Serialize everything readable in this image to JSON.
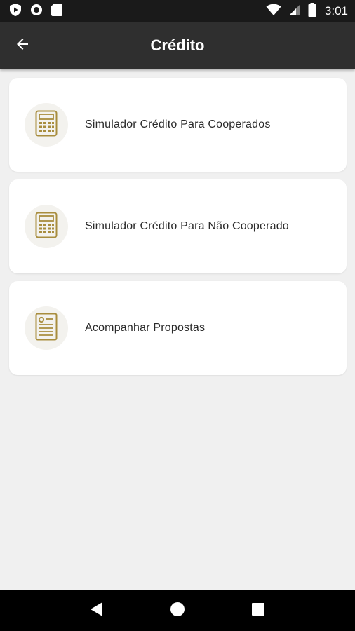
{
  "status_bar": {
    "time": "3:01",
    "icons_left": [
      "play-protect-icon",
      "circle-icon",
      "sd-card-icon"
    ],
    "icons_right": [
      "wifi-icon",
      "signal-icon",
      "battery-icon"
    ]
  },
  "app_bar": {
    "title": "Crédito",
    "back_icon": "arrow-left-icon"
  },
  "menu": {
    "items": [
      {
        "label": "Simulador Crédito Para Cooperados",
        "icon": "calculator-icon"
      },
      {
        "label": "Simulador Crédito Para Não Cooperado",
        "icon": "calculator-icon"
      },
      {
        "label": "Acompanhar Propostas",
        "icon": "document-icon"
      }
    ]
  },
  "nav_bar": {
    "buttons": [
      "back-triangle-icon",
      "home-circle-icon",
      "recents-square-icon"
    ]
  },
  "colors": {
    "status_bar_bg": "#1a1a1a",
    "app_bar_bg": "#2f2f2f",
    "page_bg": "#f0f0f0",
    "card_bg": "#ffffff",
    "icon_gold": "#a88d3e",
    "icon_circle_bg": "#f3f2ee"
  }
}
